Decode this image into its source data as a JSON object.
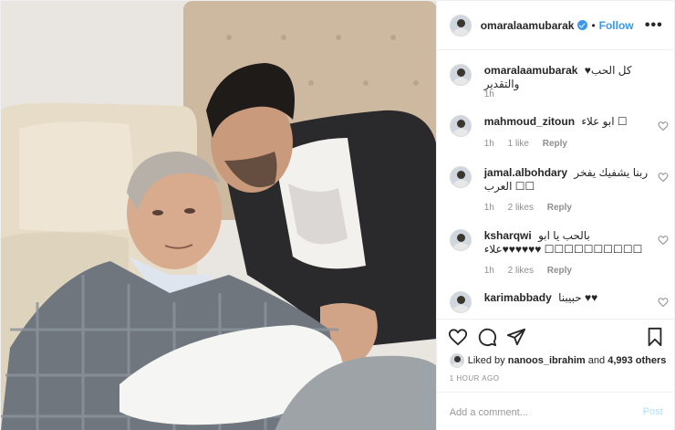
{
  "post": {
    "author": "omaralaamubarak",
    "verified": true,
    "separator": "•",
    "follow_label": "Follow",
    "more_label": "•••",
    "accent": "#3897f0"
  },
  "caption": {
    "user": "omaralaamubarak",
    "text": "♥كل الحب والتقدير",
    "time": "1h"
  },
  "comments": [
    {
      "user": "mahmoud_zitoun",
      "text": "ابو علاء ☐",
      "time": "1h",
      "likes": "1 like",
      "reply": "Reply"
    },
    {
      "user": "jamal.albohdary",
      "text": "ربنا يشفيك يفخر العرب ☐☐",
      "time": "1h",
      "likes": "2 likes",
      "reply": "Reply"
    },
    {
      "user": "ksharqwi",
      "text": "بالحب يا ابو علاء♥♥♥♥♥♥ ☐☐☐☐☐☐☐☐☐☐",
      "time": "1h",
      "likes": "2 likes",
      "reply": "Reply"
    },
    {
      "user": "karimabbady",
      "text": "حبيبنا ♥♥",
      "time": "",
      "likes": "",
      "reply": ""
    }
  ],
  "actions": {
    "icons": [
      "heart-icon",
      "comment-icon",
      "share-icon",
      "bookmark-icon"
    ]
  },
  "likes": {
    "prefix": "Liked by",
    "user": "nanoos_ibrahim",
    "joiner": "and",
    "others": "4,993 others"
  },
  "timestamp": "1 HOUR AGO",
  "add_comment": {
    "placeholder": "Add a comment...",
    "post_label": "Post"
  }
}
